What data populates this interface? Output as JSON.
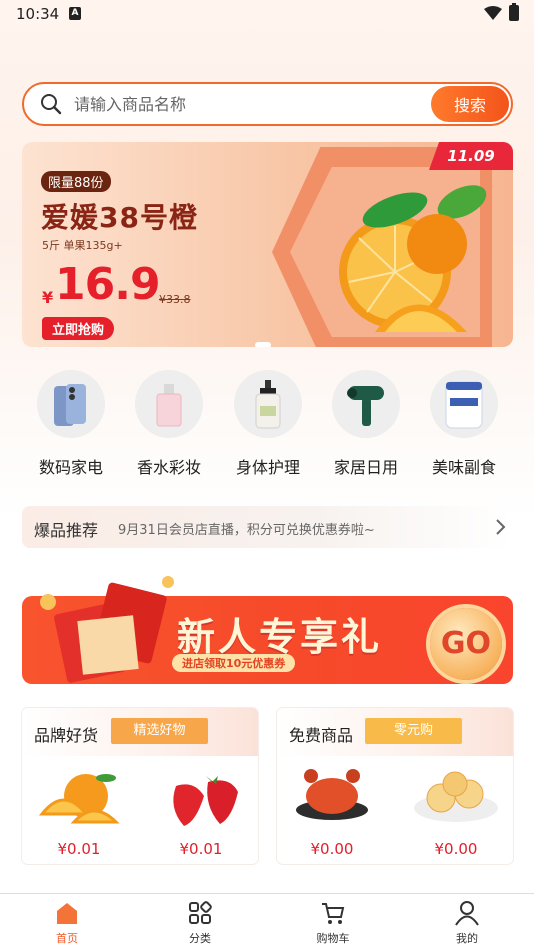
{
  "status_bar": {
    "time": "10:34",
    "a_badge": "A"
  },
  "search": {
    "placeholder": "请输入商品名称",
    "button": "搜索"
  },
  "banner": {
    "date_tag": "11.09",
    "limit_tag": "限量88份",
    "product_name": "爱媛38号橙",
    "spec": "5斤 单果135g+",
    "currency": "¥",
    "price": "16.9",
    "old_price": "¥33.8",
    "buy_button": "立即抢购"
  },
  "categories": [
    {
      "label": "数码家电",
      "icon": "phone-icon"
    },
    {
      "label": "香水彩妆",
      "icon": "perfume-icon"
    },
    {
      "label": "身体护理",
      "icon": "lotion-icon"
    },
    {
      "label": "家居日用",
      "icon": "hairdryer-icon"
    },
    {
      "label": "美味副食",
      "icon": "milk-powder-icon"
    }
  ],
  "notice": {
    "title": "爆品推荐",
    "text": "9月31日会员店直播，积分可兑换优惠券啦~"
  },
  "new_user": {
    "title": "新人专享礼",
    "subtitle": "进店领取10元优惠券",
    "go": "GO"
  },
  "cards": [
    {
      "title": "品牌好货",
      "tag": "精选好物",
      "tag_color": "#f7a64a",
      "items": [
        {
          "name": "orange",
          "price": "¥0.01"
        },
        {
          "name": "strawberry",
          "price": "¥0.01"
        }
      ]
    },
    {
      "title": "免费商品",
      "tag": "零元购",
      "tag_color": "#f8bb4a",
      "items": [
        {
          "name": "crab",
          "price": "¥0.00"
        },
        {
          "name": "pastry",
          "price": "¥0.00"
        }
      ]
    }
  ],
  "tabbar": [
    {
      "label": "首页",
      "icon": "home-icon",
      "active": true
    },
    {
      "label": "分类",
      "icon": "category-icon",
      "active": false
    },
    {
      "label": "购物车",
      "icon": "cart-icon",
      "active": false
    },
    {
      "label": "我的",
      "icon": "profile-icon",
      "active": false
    }
  ],
  "colors": {
    "accent": "#f05a2a",
    "price_red": "#e0202b"
  }
}
